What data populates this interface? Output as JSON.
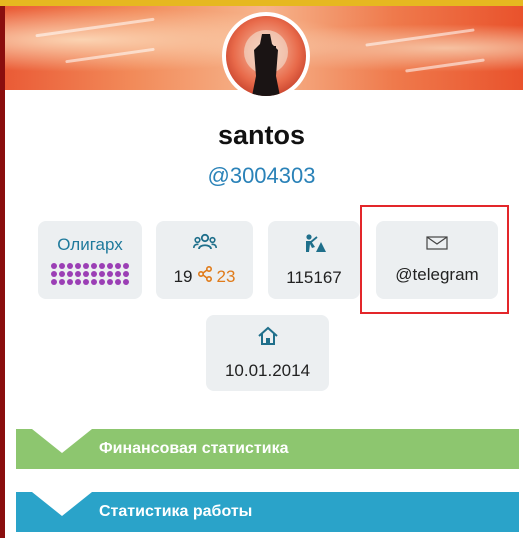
{
  "profile": {
    "username": "santos",
    "handle": "@3004303"
  },
  "cards": {
    "rank": {
      "label": "Олигарх",
      "dots": 30
    },
    "friends": {
      "count": "19",
      "shares": "23"
    },
    "work": {
      "value": "115167"
    },
    "contact": {
      "value": "@telegram"
    },
    "date": {
      "value": "10.01.2014"
    }
  },
  "sections": {
    "finance": "Финансовая статистика",
    "work": "Статистика работы"
  },
  "colors": {
    "accent_blue": "#2a82b8",
    "rank_purple": "#9b3fb5",
    "share_orange": "#e07b1a",
    "finance_green": "#8dc66f",
    "work_blue": "#2aa3c9",
    "highlight_red": "#e3262a"
  },
  "icons": [
    "users-icon",
    "share-icon",
    "worker-icon",
    "envelope-icon",
    "home-icon"
  ]
}
